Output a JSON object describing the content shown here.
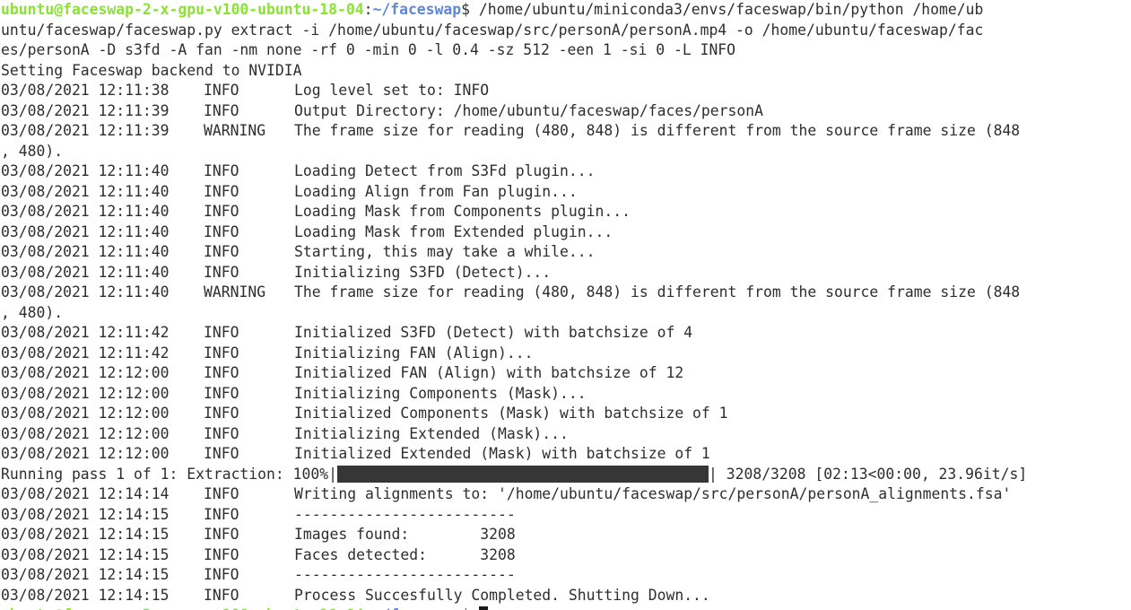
{
  "prompt": {
    "user_host": "ubuntu@faceswap-2-x-gpu-v100-ubuntu-18-04",
    "separator": ":",
    "path": "~/faceswap",
    "symbol": "$"
  },
  "command": {
    "part1": " /home/ubuntu/miniconda3/envs/faceswap/bin/python /home/ub",
    "part2": "untu/faceswap/faceswap.py extract -i /home/ubuntu/faceswap/src/personA/personA.mp4 -o /home/ubuntu/faceswap/fac",
    "part3": "es/personA -D s3fd -A fan -nm none -rf 0 -min 0 -l 0.4 -sz 512 -een 1 -si 0 -L INFO"
  },
  "backend_line": "Setting Faceswap backend to NVIDIA",
  "logs_a": [
    {
      "ts": "03/08/2021 12:11:38",
      "level": "INFO",
      "msg": "Log level set to: INFO"
    },
    {
      "ts": "03/08/2021 12:11:39",
      "level": "INFO",
      "msg": "Output Directory: /home/ubuntu/faceswap/faces/personA"
    },
    {
      "ts": "03/08/2021 12:11:39",
      "level": "WARNING",
      "msg": "The frame size for reading (480, 848) is different from the source frame size (848",
      "cont": ", 480)."
    },
    {
      "ts": "03/08/2021 12:11:40",
      "level": "INFO",
      "msg": "Loading Detect from S3Fd plugin..."
    },
    {
      "ts": "03/08/2021 12:11:40",
      "level": "INFO",
      "msg": "Loading Align from Fan plugin..."
    },
    {
      "ts": "03/08/2021 12:11:40",
      "level": "INFO",
      "msg": "Loading Mask from Components plugin..."
    },
    {
      "ts": "03/08/2021 12:11:40",
      "level": "INFO",
      "msg": "Loading Mask from Extended plugin..."
    },
    {
      "ts": "03/08/2021 12:11:40",
      "level": "INFO",
      "msg": "Starting, this may take a while..."
    },
    {
      "ts": "03/08/2021 12:11:40",
      "level": "INFO",
      "msg": "Initializing S3FD (Detect)..."
    },
    {
      "ts": "03/08/2021 12:11:40",
      "level": "WARNING",
      "msg": "The frame size for reading (480, 848) is different from the source frame size (848",
      "cont": ", 480)."
    },
    {
      "ts": "03/08/2021 12:11:42",
      "level": "INFO",
      "msg": "Initialized S3FD (Detect) with batchsize of 4"
    },
    {
      "ts": "03/08/2021 12:11:42",
      "level": "INFO",
      "msg": "Initializing FAN (Align)..."
    },
    {
      "ts": "03/08/2021 12:12:00",
      "level": "INFO",
      "msg": "Initialized FAN (Align) with batchsize of 12"
    },
    {
      "ts": "03/08/2021 12:12:00",
      "level": "INFO",
      "msg": "Initializing Components (Mask)..."
    },
    {
      "ts": "03/08/2021 12:12:00",
      "level": "INFO",
      "msg": "Initialized Components (Mask) with batchsize of 1"
    },
    {
      "ts": "03/08/2021 12:12:00",
      "level": "INFO",
      "msg": "Initializing Extended (Mask)..."
    },
    {
      "ts": "03/08/2021 12:12:00",
      "level": "INFO",
      "msg": "Initialized Extended (Mask) with batchsize of 1"
    }
  ],
  "progress": {
    "prefix": "Running pass 1 of 1: Extraction: 100%|",
    "fraction": 1.0,
    "suffix": "| 3208/3208 [02:13<00:00, 23.96it/s]"
  },
  "logs_b": [
    {
      "ts": "03/08/2021 12:14:14",
      "level": "INFO",
      "msg": "Writing alignments to: '/home/ubuntu/faceswap/src/personA/personA_alignments.fsa'"
    },
    {
      "ts": "03/08/2021 12:14:15",
      "level": "INFO",
      "msg": "-------------------------"
    },
    {
      "ts": "03/08/2021 12:14:15",
      "level": "INFO",
      "msg": "Images found:        3208"
    },
    {
      "ts": "03/08/2021 12:14:15",
      "level": "INFO",
      "msg": "Faces detected:      3208"
    },
    {
      "ts": "03/08/2021 12:14:15",
      "level": "INFO",
      "msg": "-------------------------"
    },
    {
      "ts": "03/08/2021 12:14:15",
      "level": "INFO",
      "msg": "Process Succesfully Completed. Shutting Down..."
    }
  ],
  "colors": {
    "prompt_user": "#8ae234",
    "prompt_path": "#5f87d7",
    "text": "#2e2e2e",
    "background": "#ffffff",
    "progress_fill": "#363636"
  }
}
